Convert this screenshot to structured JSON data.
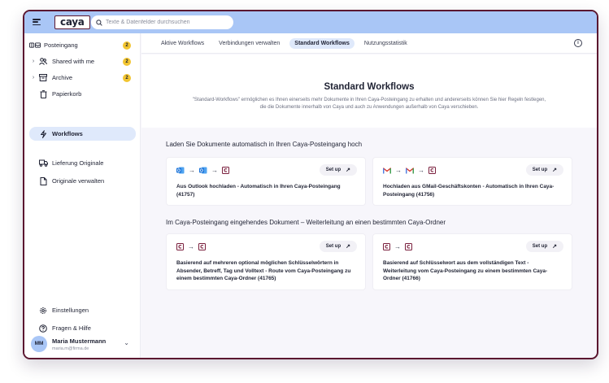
{
  "logo": "caya",
  "search": {
    "placeholder": "Texte & Datenfelder durchsuchen"
  },
  "sidebar": {
    "items": [
      {
        "label": "Posteingang",
        "badge": "2"
      },
      {
        "label": "Shared with me",
        "badge": "2"
      },
      {
        "label": "Archive",
        "badge": "2"
      },
      {
        "label": "Papierkorb"
      },
      {
        "label": "Workflows"
      },
      {
        "label": "Lieferung Originale"
      },
      {
        "label": "Originale verwalten"
      },
      {
        "label": "Einstellungen"
      },
      {
        "label": "Fragen & Hilfe"
      }
    ],
    "user": {
      "initials": "MM",
      "name": "Maria Mustermann",
      "email": "maria.m@firma.de"
    }
  },
  "tabs": [
    {
      "label": "Aktive Workflows"
    },
    {
      "label": "Verbindungen verwalten"
    },
    {
      "label": "Standard Workflows"
    },
    {
      "label": "Nutzungsstatistik"
    }
  ],
  "hero": {
    "title": "Standard Workflows",
    "description": "\"Standard-Workflows\" ermöglichen es Ihnen einerseits mehr Dokumente in Ihren Caya-Posteingang zu erhalten und andererseits können Sie hier Regeln festlegen, die die Dokumente innerhalb von Caya und auch zu Anwendungen außerhalb von Caya verschieben."
  },
  "sections": [
    {
      "title": "Laden Sie Dokumente automatisch in Ihren Caya-Posteingang hoch",
      "cards": [
        {
          "icons": [
            "outlook-icon",
            "outlook-icon",
            "caya-icon"
          ],
          "button": "Set up",
          "text": "Aus Outlook hochladen - Automatisch in Ihren Caya-Posteingang (41757)"
        },
        {
          "icons": [
            "gmail-icon",
            "gmail-icon",
            "caya-icon"
          ],
          "button": "Set up",
          "text": "Hochladen aus GMail-Geschäftskonten - Automatisch in Ihren Caya-Posteingang (41756)"
        }
      ]
    },
    {
      "title": "Im Caya-Posteingang eingehendes Dokument – Weiterleitung an einen bestimmten Caya-Ordner",
      "cards": [
        {
          "icons": [
            "caya-icon",
            "caya-icon"
          ],
          "button": "Set up",
          "text": "Basierend auf mehreren optional möglichen Schlüsselwörtern in Absender, Betreff, Tag und Volltext - Route vom Caya-Posteingang zu einem bestimmten Caya-Ordner (41765)"
        },
        {
          "icons": [
            "caya-icon",
            "caya-icon"
          ],
          "button": "Set up",
          "text": "Basierend auf Schlüsselwort aus dem vollständigen Text - Weiterleitung vom Caya-Posteingang zu einem bestimmten Caya-Ordner (41766)"
        }
      ]
    }
  ],
  "colors": {
    "accent": "#a9c6f6",
    "active": "#dfe9fb",
    "badge": "#f2c531",
    "border": "#5b1730",
    "outlook": "#1a73d9",
    "gmail": "#d93025",
    "caya": "#7a1f3d"
  }
}
